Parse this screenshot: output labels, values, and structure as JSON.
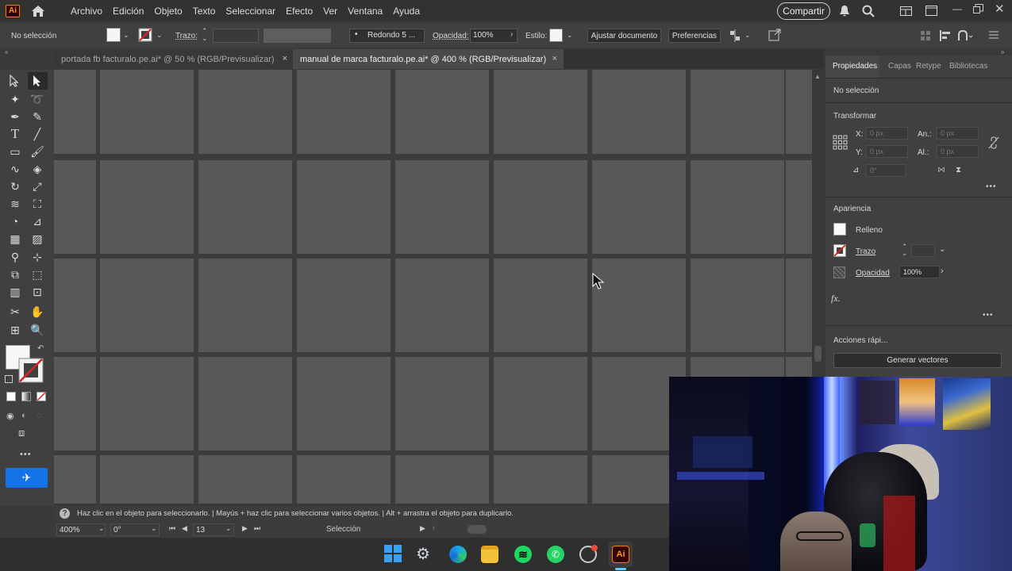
{
  "app": {
    "logo": "Ai",
    "menu": [
      "Archivo",
      "Edición",
      "Objeto",
      "Texto",
      "Seleccionar",
      "Efecto",
      "Ver",
      "Ventana",
      "Ayuda"
    ],
    "share_label": "Compartir"
  },
  "control_bar": {
    "selection_status": "No selección",
    "stroke_label": "Trazo:",
    "brush_label": "Redondo 5 ...",
    "opacity_label": "Opacidad:",
    "opacity_value": "100%",
    "style_label": "Estilo:",
    "adjust_doc_label": "Ajustar documento",
    "preferences_label": "Preferencias"
  },
  "tabs": [
    {
      "label": "portada fb facturalo.pe.ai* @ 50 % (RGB/Previsualizar)",
      "active": false
    },
    {
      "label": "manual de marca facturalo.pe.ai* @ 400 % (RGB/Previsualizar)",
      "active": true
    }
  ],
  "tab_close_glyph": "×",
  "properties": {
    "tabs": [
      "Propiedades",
      "Capas",
      "Retype",
      "Bibliotecas"
    ],
    "no_selection": "No selección",
    "transform_title": "Transformar",
    "x_label": "X:",
    "y_label": "Y:",
    "w_label": "An.:",
    "h_label": "Al.:",
    "x_value": "0 px",
    "y_value": "0 px",
    "w_value": "0 px",
    "h_value": "0 px",
    "angle_value": "0°",
    "appearance_title": "Apariencia",
    "fill_label": "Relleno",
    "stroke_label": "Trazo",
    "opacity_label": "Opacidad",
    "opacity_value": "100%",
    "fx_label": "fx.",
    "quick_actions_title": "Acciones rápi...",
    "generate_vectors_label": "Generar vectores",
    "more_glyph": "•••"
  },
  "status": {
    "help_text": "Haz clic en el objeto para seleccionarlo.  |  Mayús + haz clic para seleccionar varios objetos.  |  Alt + arrastra el objeto para duplicarlo.",
    "zoom": "400%",
    "rotation": "0°",
    "artboard": "13",
    "tool_name": "Selección"
  },
  "colors": {
    "accent": "#1473e6",
    "ai_orange": "#ff9a00",
    "ai_bg": "#330000",
    "spotify": "#1ed760",
    "whatsapp": "#25d366"
  }
}
